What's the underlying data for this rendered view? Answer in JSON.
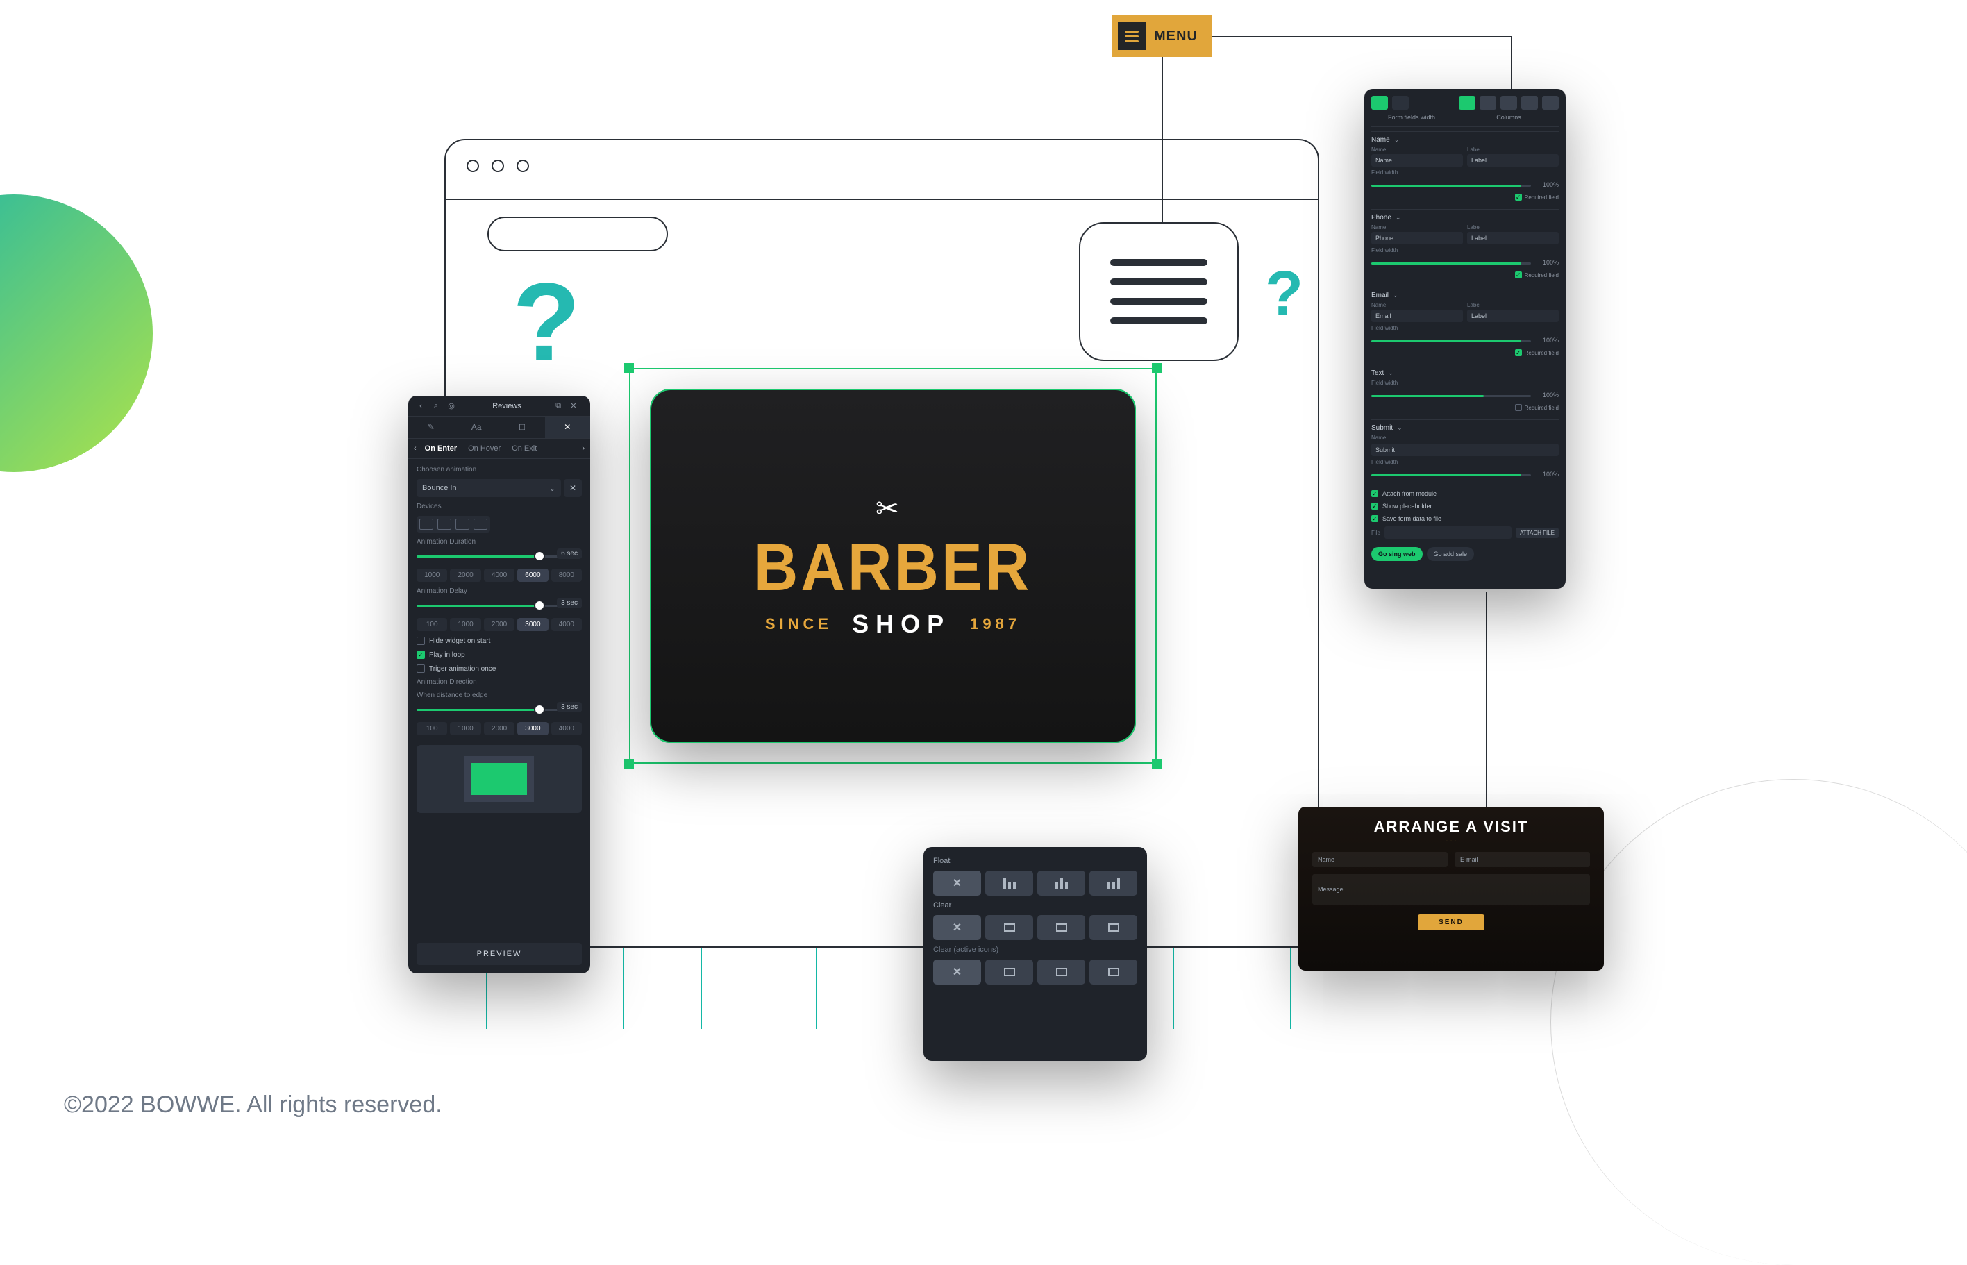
{
  "menu_badge": {
    "label": "MENU"
  },
  "barber": {
    "title": "BARBER",
    "since": "SINCE",
    "shop": "SHOP",
    "year": "1987"
  },
  "reviews_panel": {
    "title": "Reviews",
    "tabs": {
      "t1": "Aa",
      "t2": "Aa"
    },
    "subtabs": {
      "enter": "On Enter",
      "hover": "On Hover",
      "exit": "On Exit"
    },
    "choose_label": "Choosen animation",
    "animation_name": "Bounce In",
    "devices_label": "Devices",
    "duration_label": "Animation Duration",
    "duration_value": "6 sec",
    "duration_pills": [
      "1000",
      "2000",
      "4000",
      "6000",
      "8000"
    ],
    "delay_label": "Animation Delay",
    "delay_value": "3 sec",
    "delay_pills": [
      "100",
      "1000",
      "2000",
      "3000",
      "4000"
    ],
    "check_hide": "Hide widget on start",
    "check_loop": "Play in loop",
    "check_once": "Triger animation once",
    "direction_label": "Animation Direction",
    "edge_label": "When distance to edge",
    "edge_value": "3 sec",
    "edge_pills": [
      "100",
      "1000",
      "2000",
      "3000",
      "4000"
    ],
    "preview_btn": "PREVIEW"
  },
  "float_panel": {
    "float_label": "Float",
    "clear_label": "Clear",
    "clear_active_label": "Clear",
    "clear_active_hint": "(active icons)"
  },
  "form_panel": {
    "head_left": "Form fields width",
    "head_right": "Columns",
    "sections": {
      "name": {
        "title": "Name",
        "name_label": "Name",
        "name_value": "Name",
        "label_label": "Label",
        "label_value": "Label",
        "width_label": "Field width",
        "width_value": "100%",
        "required": "Required field"
      },
      "phone": {
        "title": "Phone",
        "name_label": "Name",
        "name_value": "Phone",
        "label_label": "Label",
        "label_value": "Label",
        "width_label": "Field width",
        "width_value": "100%",
        "required": "Required field"
      },
      "email": {
        "title": "Email",
        "name_label": "Name",
        "name_value": "Email",
        "label_label": "Label",
        "label_value": "Label",
        "width_label": "Field width",
        "width_value": "100%",
        "required": "Required field"
      },
      "text": {
        "title": "Text",
        "width_label": "Field width",
        "width_value": "100%",
        "required": "Required field"
      },
      "submit": {
        "title": "Submit",
        "name_label": "Name",
        "name_value": "Submit",
        "width_label": "Field width",
        "width_value": "100%"
      }
    },
    "check_attach": "Attach from module",
    "check_placeholder": "Show placeholder",
    "check_save": "Save form data to file",
    "file_label": "File",
    "file_btn": "ATTACH FILE",
    "cta_signup": "Go sing web",
    "cta_alt": "Go add sale"
  },
  "arrange": {
    "title": "ARRANGE A VISIT",
    "field_name": "Name",
    "field_email": "E-mail",
    "field_message": "Message",
    "send": "SEND"
  },
  "copyright": "©2022 BOWWE. All rights reserved."
}
